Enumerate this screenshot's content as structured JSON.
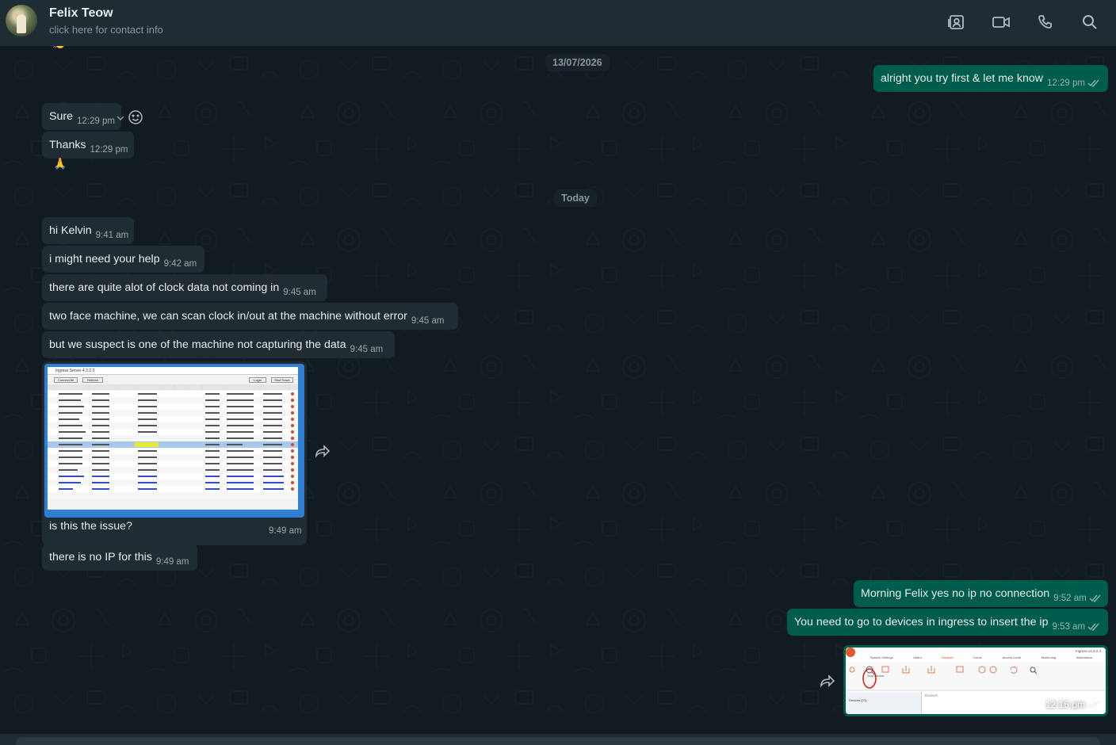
{
  "header": {
    "name": "Felix Teow",
    "subtitle": "click here for contact info",
    "icons": [
      "contact-card-icon",
      "video-call-icon",
      "phone-icon",
      "search-icon"
    ]
  },
  "dates": {
    "first": "13/07/2026",
    "second": "Today"
  },
  "messages": {
    "m1": {
      "text": "alright you try first & let me know",
      "time": "12:29 pm"
    },
    "m2": {
      "text": "Sure",
      "time": "12:29 pm"
    },
    "m3": {
      "text": "Thanks",
      "time": "12:29 pm",
      "reaction": "🙏"
    },
    "m4": {
      "text": "hi Kelvin",
      "time": "9:41 am"
    },
    "m5": {
      "text": "i might need your help",
      "time": "9:42 am"
    },
    "m6": {
      "text": "there are quite alot of clock data not coming in",
      "time": "9:45 am"
    },
    "m7": {
      "text": "two face machine, we can scan clock in/out at the machine without error",
      "time": "9:45 am"
    },
    "m8": {
      "text": "but we suspect is one of the machine not capturing the data",
      "time": "9:45 am"
    },
    "m9": {
      "caption": "is this the issue?",
      "time": "9:49 am"
    },
    "m10": {
      "text": "there is no IP for this",
      "time": "9:49 am"
    },
    "m11": {
      "text": "Morning Felix yes no ip no connection",
      "time": "9:52 am"
    },
    "m12": {
      "text": "You need to go to devices in ingress to insert the ip",
      "time": "9:53 am"
    },
    "m13": {
      "time": "12:16 pm"
    }
  },
  "screenshot1": {
    "title": "Ingress Server 4.3.2.3",
    "buttons": [
      "Connect All",
      "Refresh",
      "Login",
      "Shut Down"
    ]
  },
  "screenshot2": {
    "title": "Ingress v4.3.2.3",
    "tabs": [
      "System Settings",
      "Users",
      "Devices",
      "Doors",
      "Access Level",
      "Monitoring",
      "Attendance"
    ],
    "scan_label": "Scan Devices",
    "devices_label": "Devices",
    "tree_item": "Devices (21)"
  },
  "colors": {
    "incoming": "#202c33",
    "outgoing": "#005c4b",
    "background": "#111b21",
    "header": "#202c33"
  }
}
